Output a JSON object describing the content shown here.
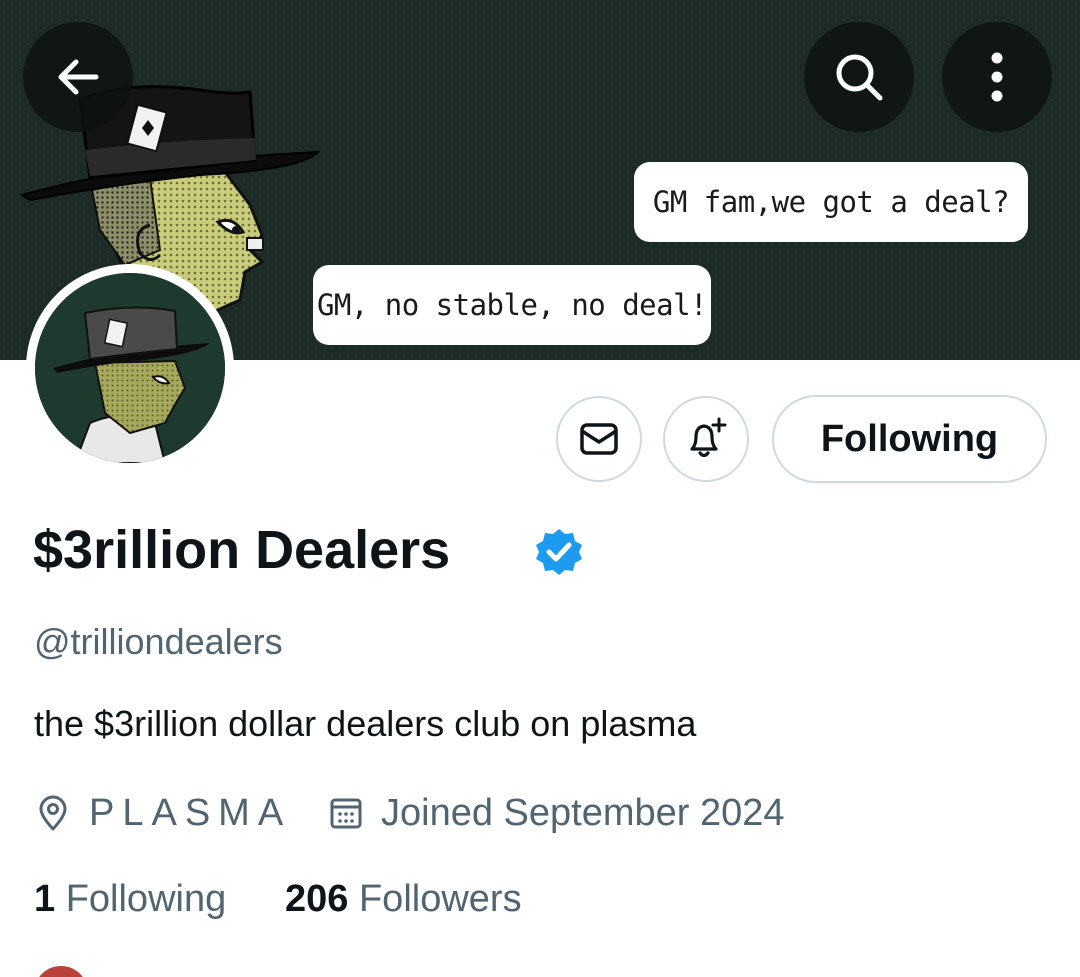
{
  "header": {
    "back_icon": "arrow-left-icon",
    "search_icon": "search-icon",
    "more_icon": "more-vertical-icon"
  },
  "banner": {
    "bubble_top": "GM fam,we got a deal?",
    "bubble_bottom": "GM, no stable, no deal!",
    "background_color": "#1c2b26"
  },
  "actions": {
    "message_icon": "mail-icon",
    "notify_icon": "bell-plus-icon",
    "following_label": "Following"
  },
  "profile": {
    "display_name": "$3rillion Dealers",
    "verified": true,
    "verified_color": "#1d9bf0",
    "handle": "@trilliondealers",
    "bio": "the $3rillion dollar dealers club on plasma",
    "location": "PLASMA",
    "joined": "Joined September 2024"
  },
  "stats": {
    "following_count": "1",
    "following_label": "Following",
    "followers_count": "206",
    "followers_label": "Followers"
  }
}
